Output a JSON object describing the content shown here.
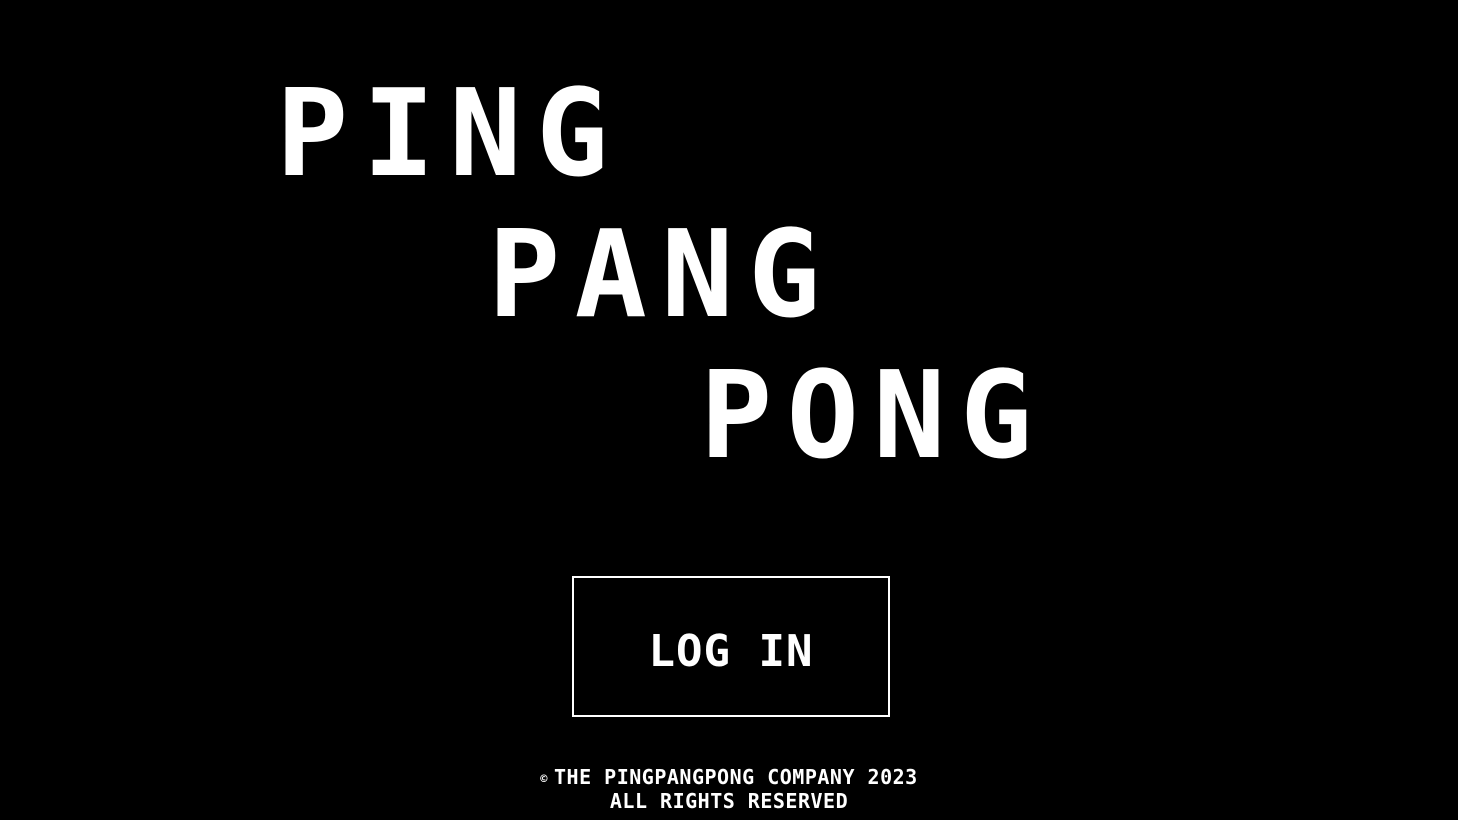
{
  "title": {
    "line1": "PING",
    "line2": "PANG",
    "line3": "PONG"
  },
  "login_button": {
    "label": "LOG IN"
  },
  "footer": {
    "copyright_symbol": "©",
    "company_line": "THE PINGPANGPONG COMPANY 2023",
    "rights_line": "ALL RIGHTS RESERVED"
  },
  "colors": {
    "background": "#000000",
    "foreground": "#ffffff"
  }
}
